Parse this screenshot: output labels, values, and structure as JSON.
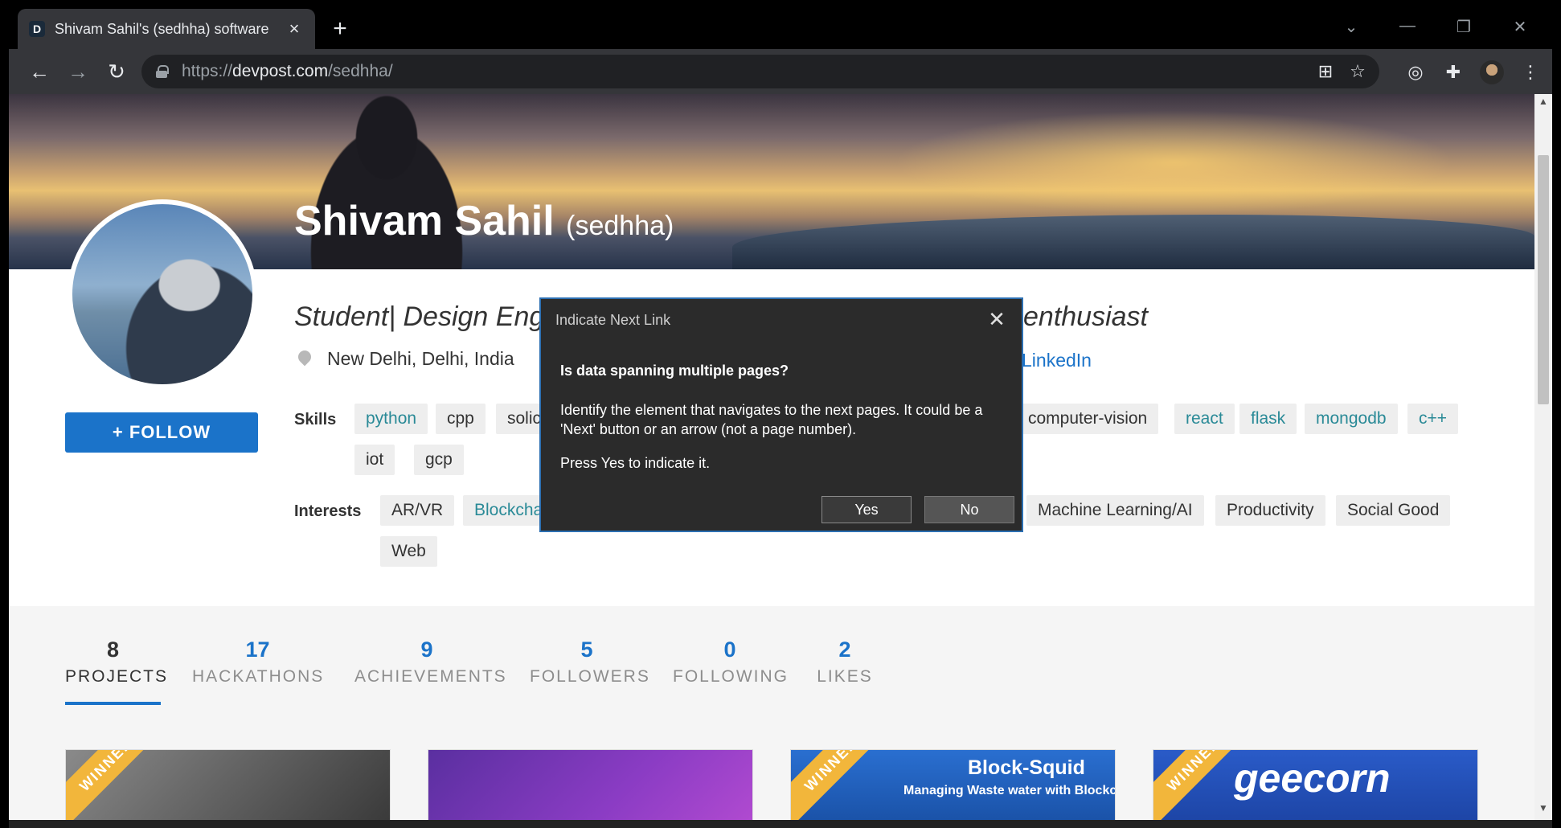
{
  "browser": {
    "tab_title": "Shivam Sahil's (sedhha) software",
    "tab_favicon": "D",
    "url_scheme": "https://",
    "url_host": "devpost.com",
    "url_path": "/sedhha/"
  },
  "profile": {
    "name": "Shivam Sahil",
    "username": "(sedhha)",
    "tagline_start": "Student| Design Engi",
    "tagline_end": "enthusiast",
    "location": "New Delhi, Delhi, India",
    "linkedin": "LinkedIn",
    "follow_label": "+ FOLLOW",
    "skills_label": "Skills",
    "interests_label": "Interests",
    "skills": [
      "python",
      "cpp",
      "solic",
      "computer-vision",
      "react",
      "flask",
      "mongodb",
      "c++",
      "iot",
      "gcp"
    ],
    "interests": [
      "AR/VR",
      "Blockcha",
      "Machine Learning/AI",
      "Productivity",
      "Social Good",
      "Web"
    ]
  },
  "stats": [
    {
      "num": "8",
      "label": "PROJECTS"
    },
    {
      "num": "17",
      "label": "HACKATHONS"
    },
    {
      "num": "9",
      "label": "ACHIEVEMENTS"
    },
    {
      "num": "5",
      "label": "FOLLOWERS"
    },
    {
      "num": "0",
      "label": "FOLLOWING"
    },
    {
      "num": "2",
      "label": "LIKES"
    }
  ],
  "cards": {
    "ribbon": "WINNER",
    "card3_title": "Block-Squid",
    "card3_sub": "Managing Waste water with Blockch",
    "card4_logo": "geecorn"
  },
  "dialog": {
    "title": "Indicate Next Link",
    "question": "Is data spanning multiple pages?",
    "body": "Identify the element that navigates to the next pages. It could be a 'Next' button or an arrow (not a page number).",
    "press": "Press Yes to indicate it.",
    "yes": "Yes",
    "no": "No"
  }
}
